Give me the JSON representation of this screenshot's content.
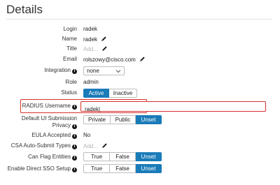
{
  "header": {
    "title": "Details"
  },
  "fields": {
    "login": {
      "label": "Login",
      "value": "radek"
    },
    "name": {
      "label": "Name",
      "value": "radek"
    },
    "title": {
      "label": "Title",
      "placeholder": "Add..."
    },
    "email": {
      "label": "Email",
      "value": "rolszowy@cisco.com"
    },
    "integration": {
      "label": "Integration",
      "value": "none"
    },
    "role": {
      "label": "Role",
      "value": "admin"
    },
    "status": {
      "label": "Status",
      "options": [
        "Active",
        "Inactive"
      ],
      "selected": "Active"
    },
    "radius_username": {
      "label": "RADIUS Username",
      "value": "radek|"
    },
    "default_ui_submission_privacy": {
      "label_line1": "Default UI Submission",
      "label_line2": "Privacy",
      "options": [
        "Private",
        "Public",
        "Unset"
      ],
      "selected": "Unset"
    },
    "eula_accepted": {
      "label": "EULA Accepted",
      "value": "No"
    },
    "csa_auto_submit_types": {
      "label": "CSA Auto-Submit Types",
      "placeholder": "Add..."
    },
    "can_flag_entities": {
      "label": "Can Flag Entities",
      "options": [
        "True",
        "False",
        "Unset"
      ],
      "selected": "Unset"
    },
    "enable_direct_sso_setup": {
      "label": "Enable Direct SSO Setup",
      "options": [
        "True",
        "False",
        "Unset"
      ],
      "selected": "Unset"
    }
  },
  "icons": {
    "info": "info-icon",
    "edit": "pencil-icon",
    "dropdown": "chevron-down-icon"
  },
  "colors": {
    "accent": "#1a7bb9",
    "highlight": "#d9302b"
  }
}
